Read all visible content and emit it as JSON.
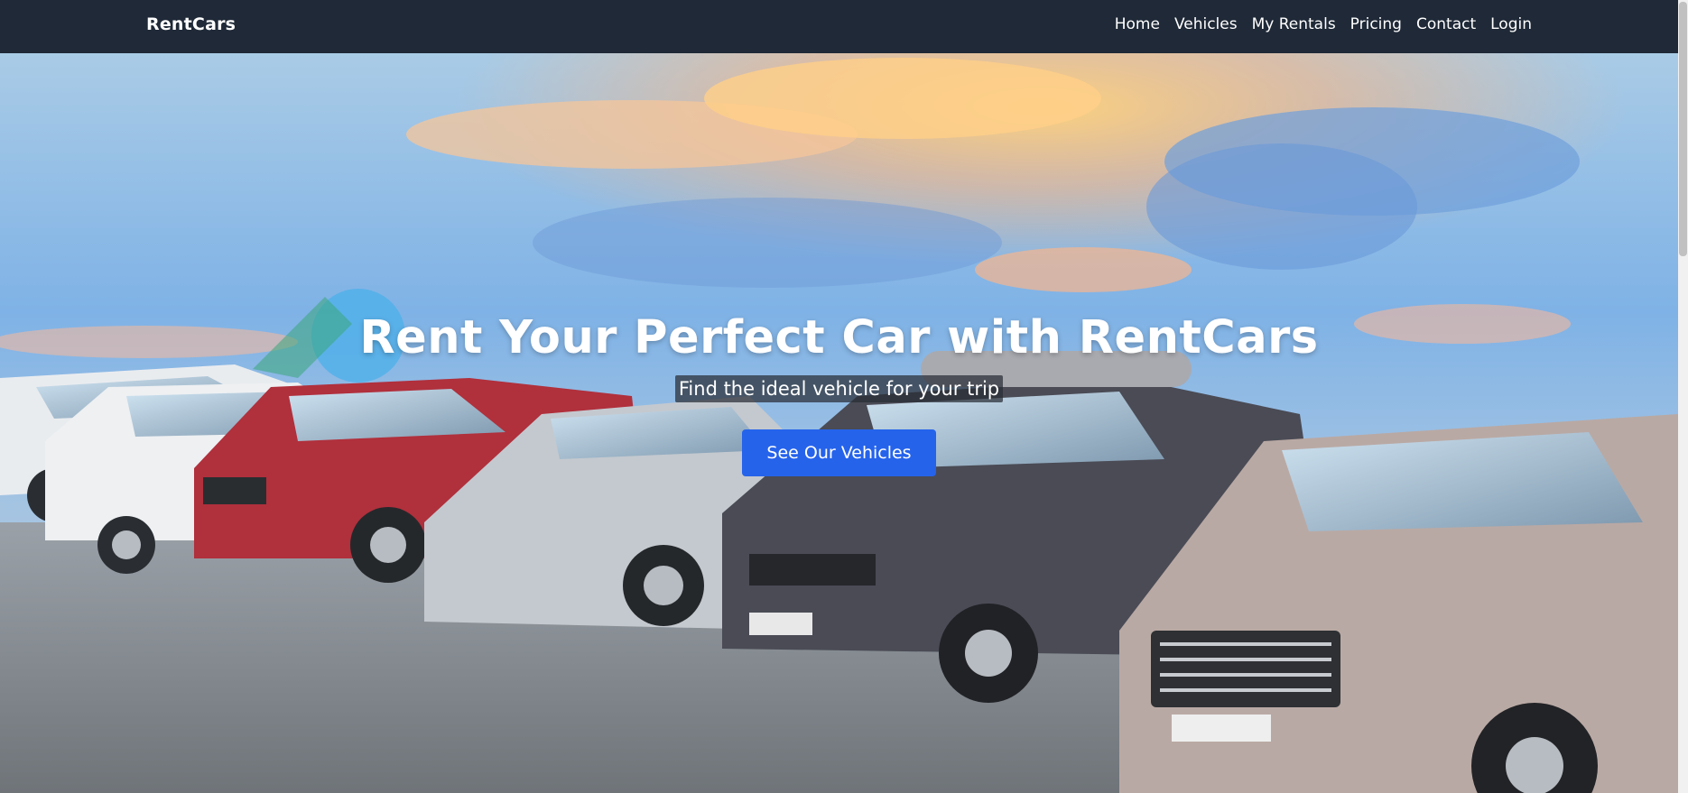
{
  "navbar": {
    "brand": "RentCars",
    "links": [
      "Home",
      "Vehicles",
      "My Rentals",
      "Pricing",
      "Contact",
      "Login"
    ],
    "background": "#1f2937"
  },
  "hero": {
    "title": "Rent Your Perfect Car with RentCars",
    "subtitle": "Find the ideal vehicle for your trip",
    "cta_label": "See Our Vehicles",
    "cta_color": "#2563eb",
    "background_image": "car-rental-lot-photo"
  }
}
